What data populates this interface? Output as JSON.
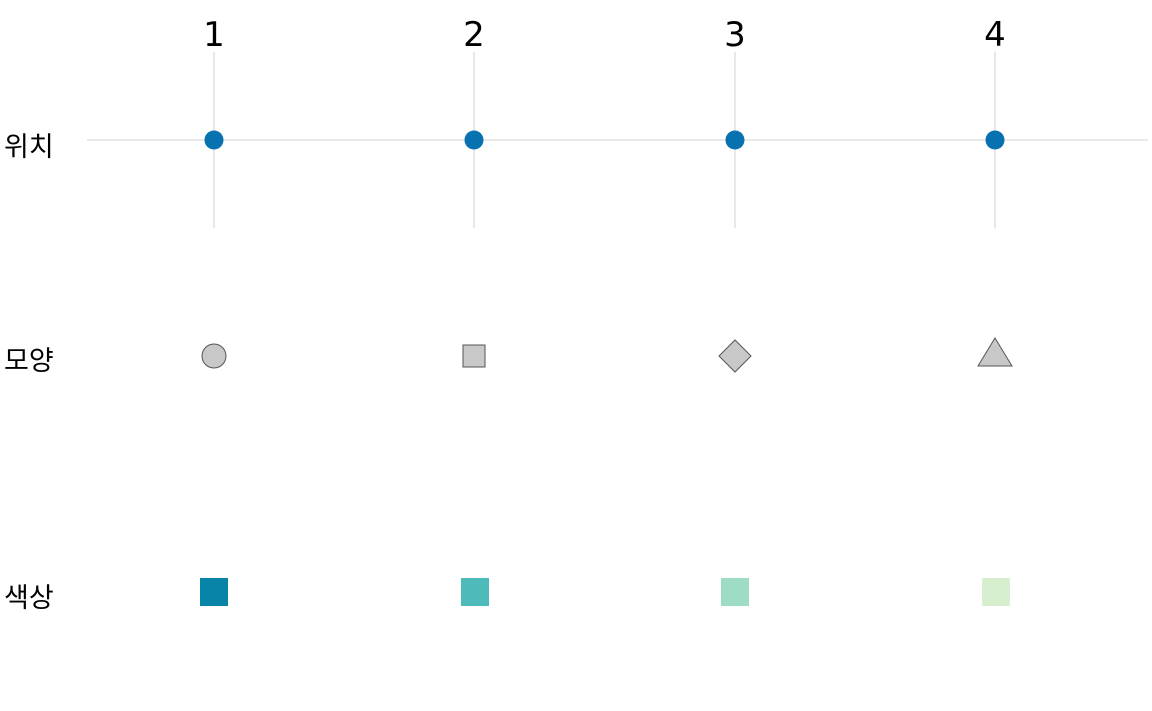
{
  "columns": [
    "1",
    "2",
    "3",
    "4"
  ],
  "rows": {
    "position": {
      "label": "위치",
      "point_color": "#0872B0"
    },
    "shape": {
      "label": "모양",
      "shapes": [
        "circle",
        "square",
        "diamond",
        "triangle"
      ],
      "fill": "#C8C8C8",
      "stroke": "#555555"
    },
    "color": {
      "label": "색상",
      "swatches": [
        "#0784A8",
        "#4EBBBA",
        "#9EDCC4",
        "#D7EFCF"
      ]
    }
  },
  "grid_color": "#E3E3E3"
}
